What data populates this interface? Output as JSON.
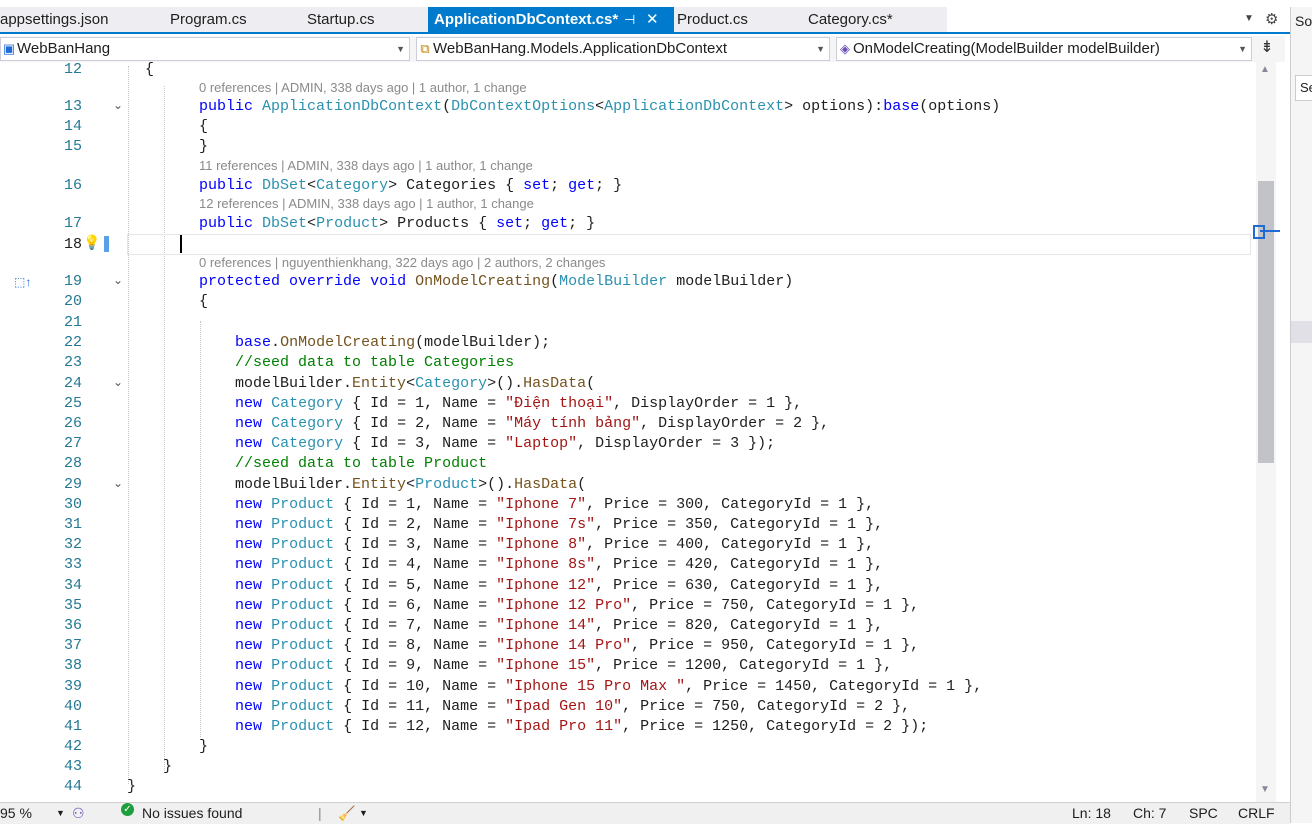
{
  "tabs": [
    {
      "label": "appsettings.json"
    },
    {
      "label": "Program.cs"
    },
    {
      "label": "Startup.cs"
    },
    {
      "label": "ApplicationDbContext.cs*",
      "active": true
    },
    {
      "label": "Product.cs"
    },
    {
      "label": "Category.cs*"
    }
  ],
  "nav": {
    "project": "WebBanHang",
    "class": "WebBanHang.Models.ApplicationDbContext",
    "member": "OnModelCreating(ModelBuilder modelBuilder)"
  },
  "right_panel": {
    "title": "So",
    "search_placeholder": "Se"
  },
  "code_lens": {
    "l13": "0 references | ADMIN, 338 days ago | 1 author, 1 change",
    "l16": "11 references | ADMIN, 338 days ago | 1 author, 1 change",
    "l17": "12 references | ADMIN, 338 days ago | 1 author, 1 change",
    "l19": "0 references | nguyenthienkhang, 322 days ago | 2 authors, 2 changes"
  },
  "line_numbers": [
    "12",
    "13",
    "14",
    "15",
    "16",
    "17",
    "18",
    "19",
    "20",
    "21",
    "22",
    "23",
    "24",
    "25",
    "26",
    "27",
    "28",
    "29",
    "30",
    "31",
    "32",
    "33",
    "34",
    "35",
    "36",
    "37",
    "38",
    "39",
    "40",
    "41",
    "42",
    "43",
    "44"
  ],
  "status": {
    "zoom": "95 %",
    "issues": "No issues found",
    "ln": "Ln: 18",
    "ch": "Ch: 7",
    "spc": "SPC",
    "crlf": "CRLF"
  },
  "colors": {
    "accent": "#007acc",
    "keyword": "#0000ff",
    "type": "#2b91af",
    "string": "#a31515",
    "comment": "#008000",
    "line_number": "#237893"
  }
}
